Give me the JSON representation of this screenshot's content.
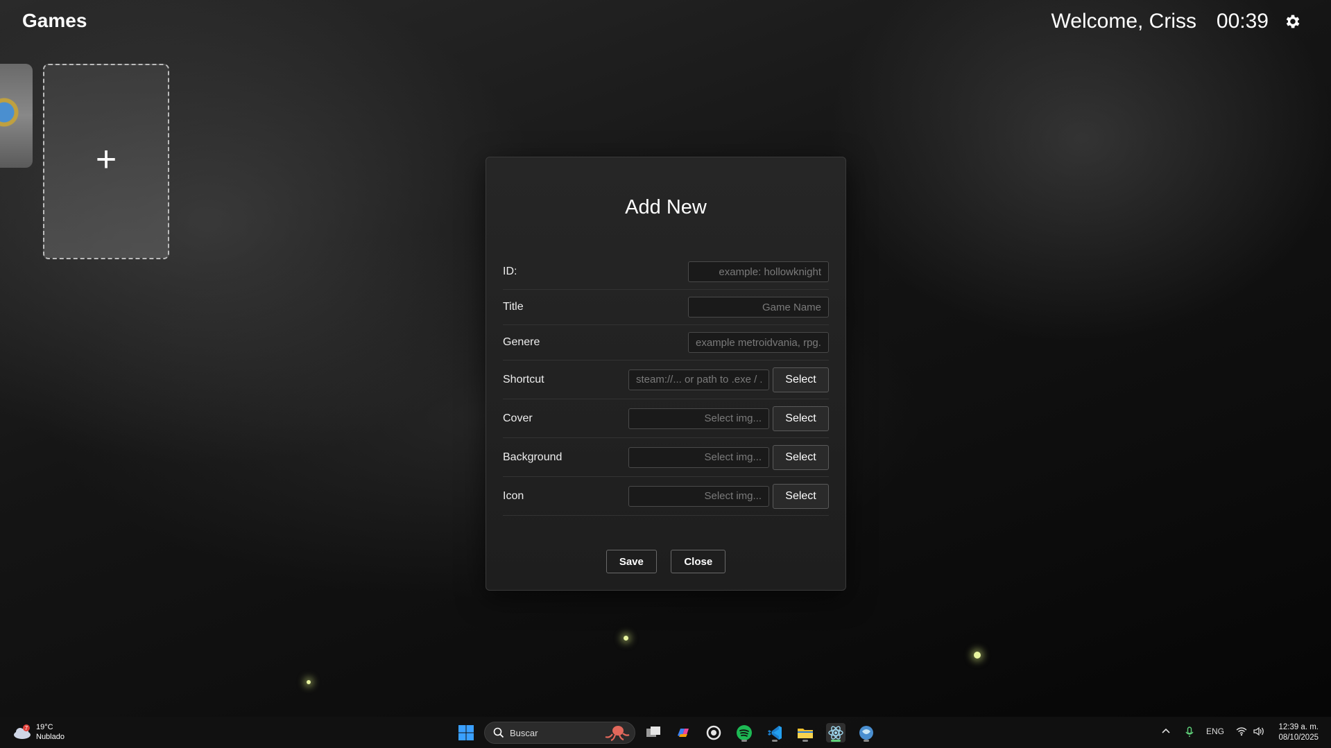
{
  "header": {
    "title": "Games",
    "welcome": "Welcome, Criss",
    "time": "00:39",
    "settings_icon": "gear-icon"
  },
  "library": {
    "add_card_symbol": "+"
  },
  "modal": {
    "title": "Add New",
    "fields": {
      "id": {
        "label": "ID:",
        "placeholder": "example: hollowknight",
        "value": ""
      },
      "title": {
        "label": "Title",
        "placeholder": "Game Name",
        "value": ""
      },
      "genre": {
        "label": "Genere",
        "placeholder": "example metroidvania, rpg...",
        "value": ""
      },
      "shortcut": {
        "label": "Shortcut",
        "placeholder": "steam://... or path to .exe / .lnk",
        "value": "",
        "button": "Select"
      },
      "cover": {
        "label": "Cover",
        "placeholder": "Select img...",
        "value": "",
        "button": "Select"
      },
      "background": {
        "label": "Background",
        "placeholder": "Select img...",
        "value": "",
        "button": "Select"
      },
      "icon": {
        "label": "Icon",
        "placeholder": "Select img...",
        "value": "",
        "button": "Select"
      }
    },
    "save_label": "Save",
    "close_label": "Close"
  },
  "taskbar": {
    "weather": {
      "temp": "19°C",
      "condition": "Nublado",
      "badge": "7"
    },
    "search_placeholder": "Buscar",
    "lang": "ENG",
    "time": "12:39 a. m.",
    "date": "08/10/2025"
  },
  "colors": {
    "accent_spotify": "#1db954",
    "accent_vscode": "#23a0f0",
    "accent_windows": "#3aa0ff"
  }
}
